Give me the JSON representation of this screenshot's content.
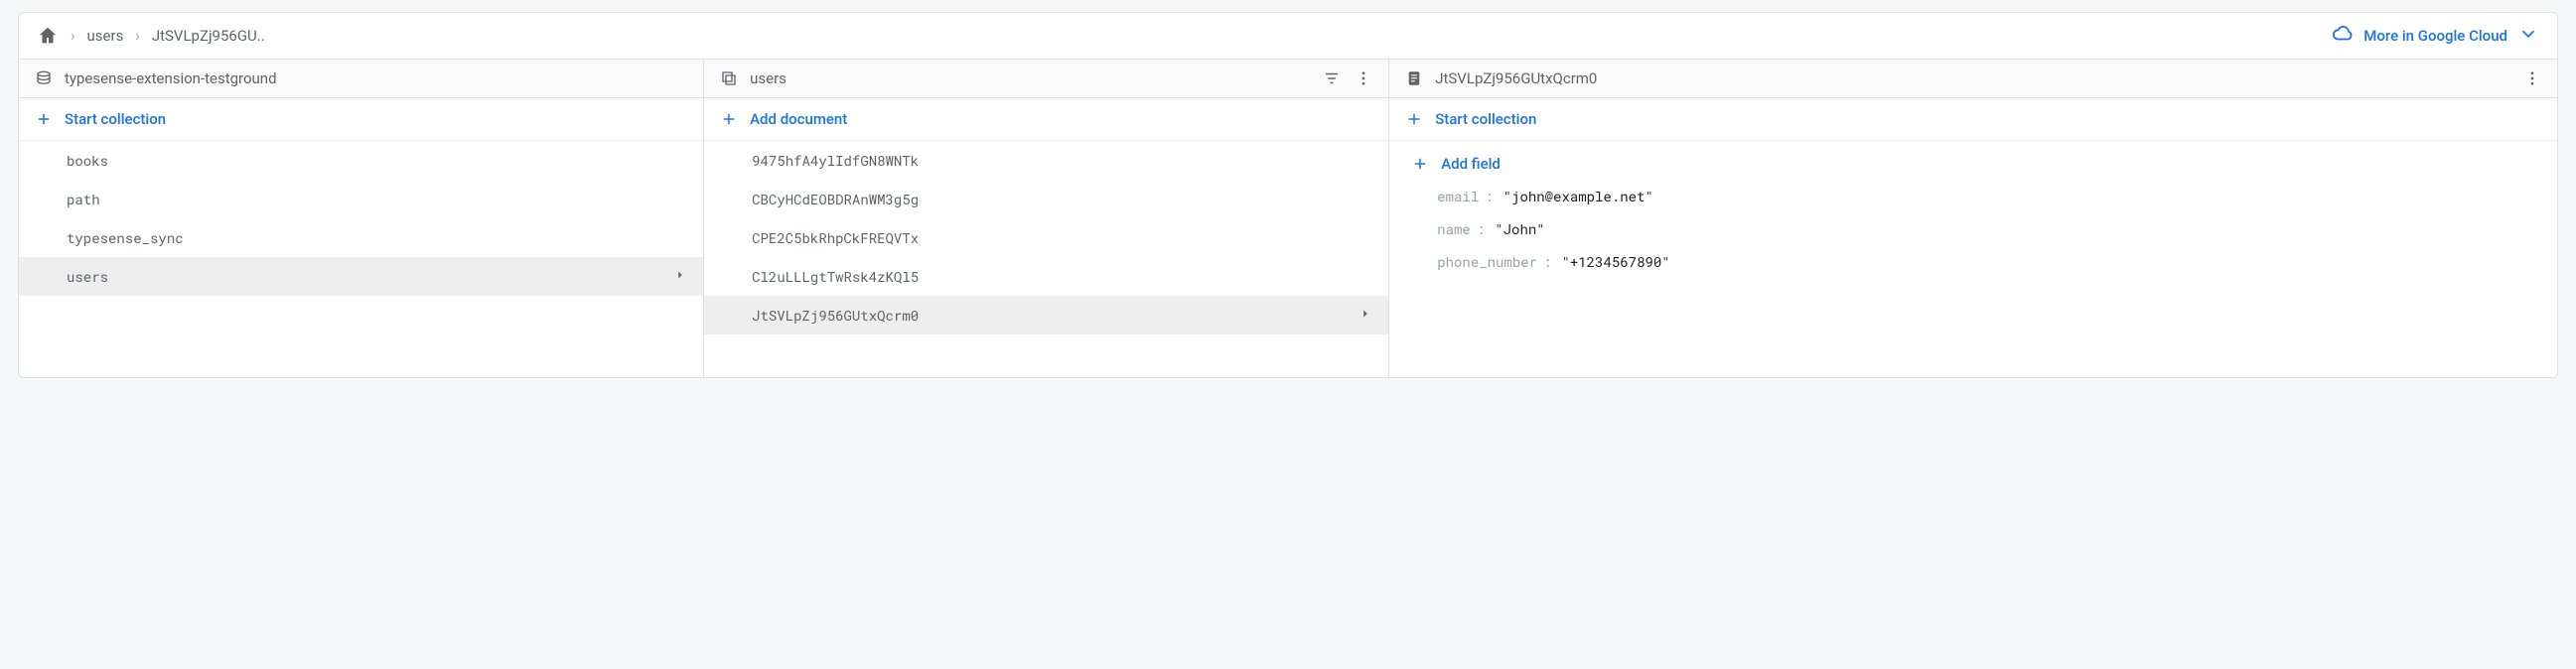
{
  "breadcrumb": {
    "users": "users",
    "doc": "JtSVLpZj956GU.."
  },
  "topbar": {
    "more_label": "More in Google Cloud"
  },
  "panelA": {
    "header": "typesense-extension-testground",
    "start_collection": "Start collection",
    "items": [
      "books",
      "path",
      "typesense_sync",
      "users"
    ],
    "selected_index": 3
  },
  "panelB": {
    "header": "users",
    "add_document": "Add document",
    "items": [
      "9475hfA4ylIdfGN8WNTk",
      "CBCyHCdEOBDRAnWM3g5g",
      "CPE2C5bkRhpCkFREQVTx",
      "Cl2uLLLgtTwRsk4zKQl5",
      "JtSVLpZj956GUtxQcrm0"
    ],
    "selected_index": 4
  },
  "panelC": {
    "header": "JtSVLpZj956GUtxQcrm0",
    "start_collection": "Start collection",
    "add_field": "Add field",
    "fields": [
      {
        "key": "email",
        "value": "\"john@example.net\""
      },
      {
        "key": "name",
        "value": "\"John\""
      },
      {
        "key": "phone_number",
        "value": "\"+1234567890\""
      }
    ]
  }
}
